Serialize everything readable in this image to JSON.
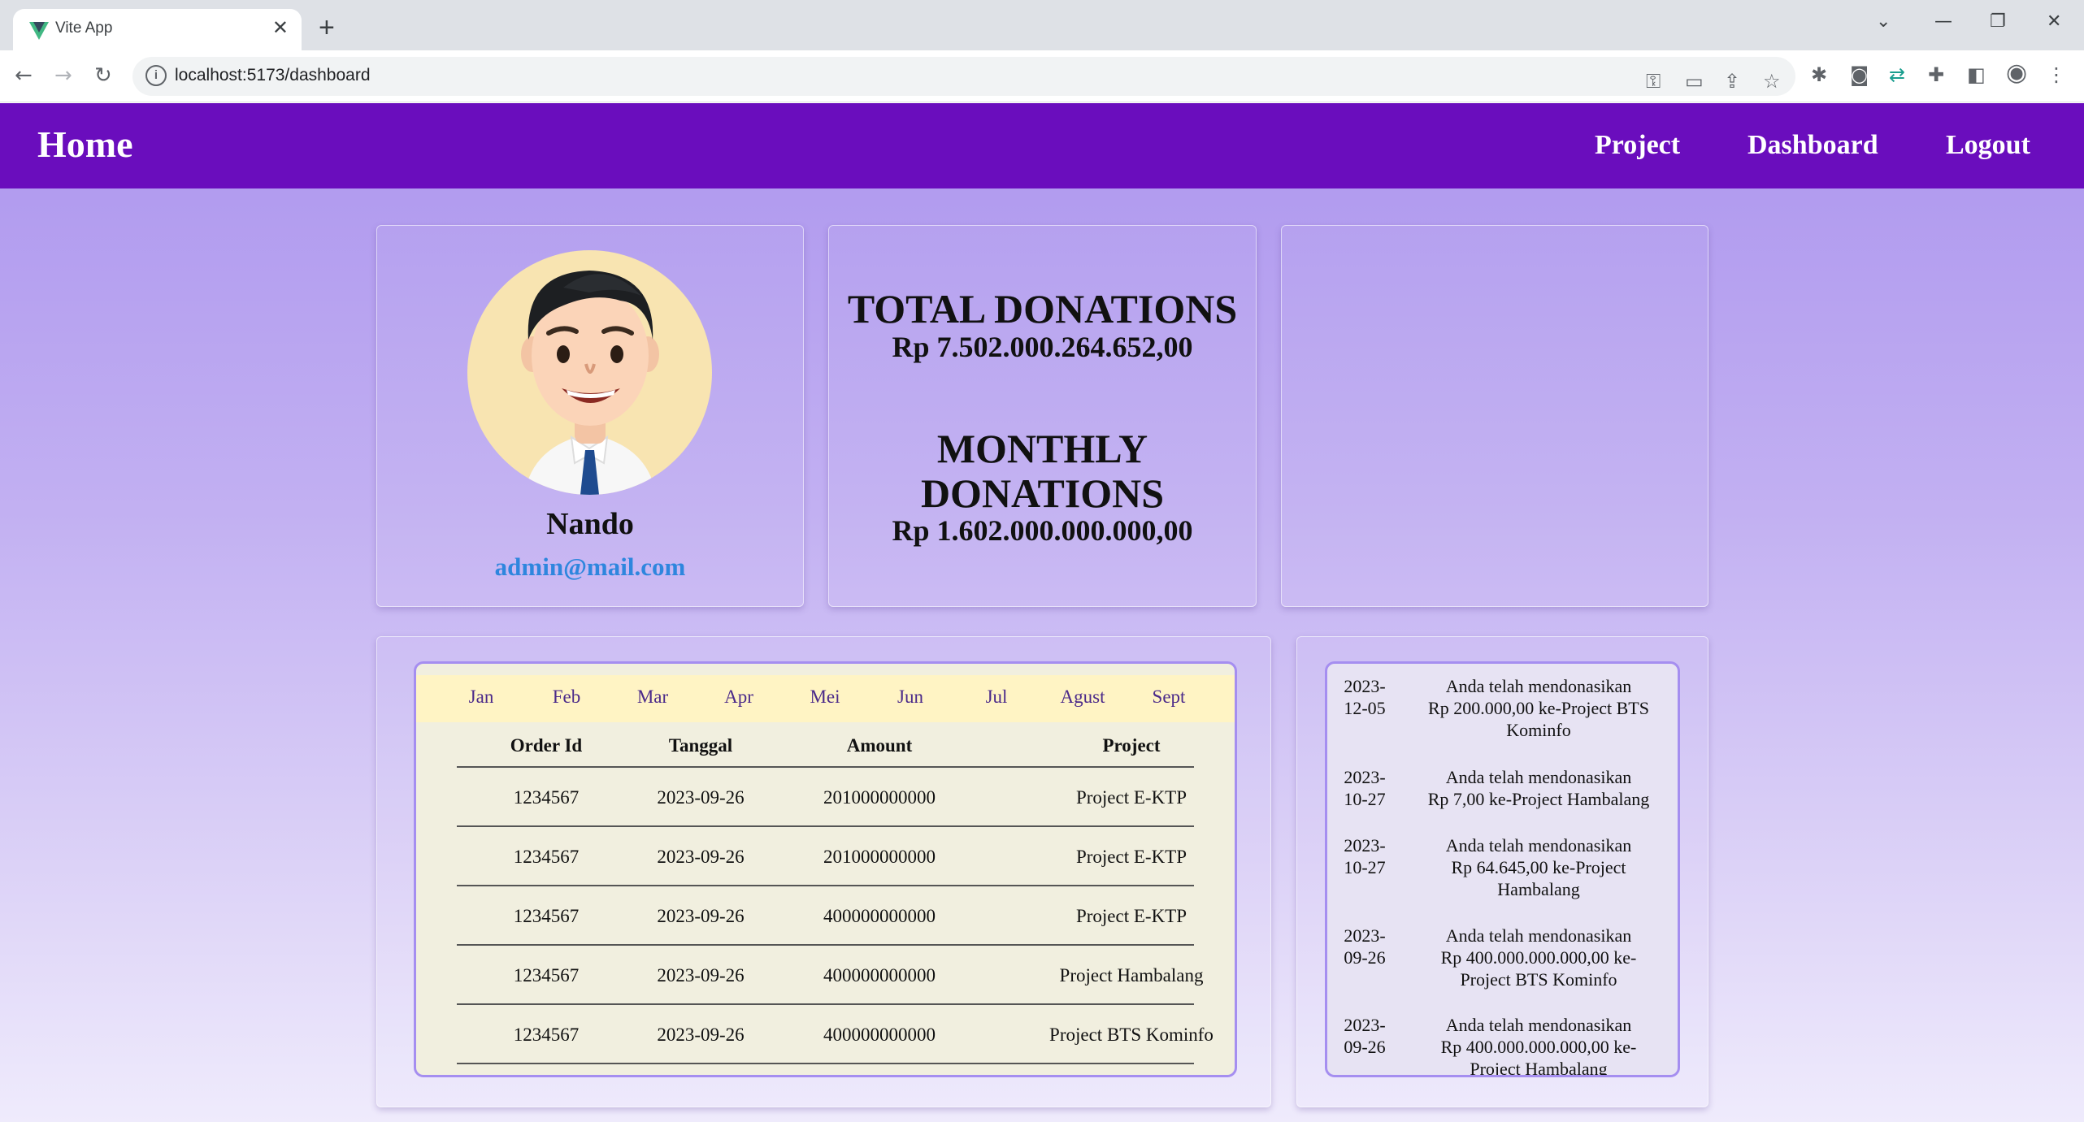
{
  "browser": {
    "tab_title": "Vite App",
    "tab_close": "✕",
    "new_tab": "+",
    "url": "localhost:5173/dashboard",
    "info_icon": "i"
  },
  "navbar": {
    "home": "Home",
    "links": [
      "Project",
      "Dashboard",
      "Logout"
    ]
  },
  "profile": {
    "name": "Nando",
    "email": "admin@mail.com"
  },
  "donations": {
    "total_title": "TOTAL DONATIONS",
    "total_value": "Rp 7.502.000.264.652,00",
    "monthly_title_line1": "MONTHLY",
    "monthly_title_line2": "DONATIONS",
    "monthly_value": "Rp 1.602.000.000.000,00"
  },
  "months": [
    "Jan",
    "Feb",
    "Mar",
    "Apr",
    "Mei",
    "Jun",
    "Jul",
    "Agust",
    "Sept"
  ],
  "orders": {
    "headers": [
      "Order Id",
      "Tanggal",
      "Amount",
      "Project"
    ],
    "rows": [
      [
        "1234567",
        "2023-09-26",
        "201000000000",
        "Project E-KTP"
      ],
      [
        "1234567",
        "2023-09-26",
        "201000000000",
        "Project E-KTP"
      ],
      [
        "1234567",
        "2023-09-26",
        "400000000000",
        "Project E-KTP"
      ],
      [
        "1234567",
        "2023-09-26",
        "400000000000",
        "Project Hambalang"
      ],
      [
        "1234567",
        "2023-09-26",
        "400000000000",
        "Project BTS Kominfo"
      ]
    ]
  },
  "activity": [
    {
      "date1": "2023-",
      "date2": "12-05",
      "l1": "Anda telah mendonasikan",
      "l2": "Rp 200.000,00 ke-Project BTS",
      "l3": "Kominfo"
    },
    {
      "date1": "2023-",
      "date2": "10-27",
      "l1": "Anda telah mendonasikan",
      "l2": "Rp 7,00 ke-Project Hambalang",
      "l3": ""
    },
    {
      "date1": "2023-",
      "date2": "10-27",
      "l1": "Anda telah mendonasikan",
      "l2": "Rp 64.645,00 ke-Project",
      "l3": "Hambalang"
    },
    {
      "date1": "2023-",
      "date2": "09-26",
      "l1": "Anda telah mendonasikan",
      "l2": "Rp 400.000.000.000,00 ke-",
      "l3": "Project BTS Kominfo"
    },
    {
      "date1": "2023-",
      "date2": "09-26",
      "l1": "Anda telah mendonasikan",
      "l2": "Rp 400.000.000.000,00 ke-",
      "l3": "Project Hambalang"
    }
  ],
  "colors": {
    "navbar": "#6a0dbd",
    "email": "#2e86de",
    "frame_border": "#a58ef0"
  }
}
